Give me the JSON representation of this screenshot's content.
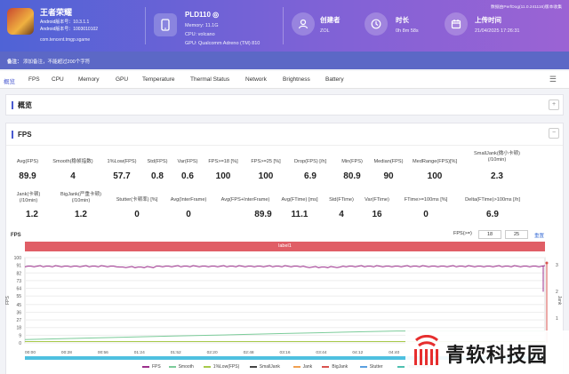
{
  "header": {
    "app_name": "王者荣耀",
    "android_version": "Android版本号：10.3.1.1",
    "android_version_code": "Android版本号：1003010102",
    "package": "com.tencent.tmgp.sgame",
    "device_name": "PLD110 ◎",
    "memory": "Memory: 11.1G",
    "cpu": "CPU: volcano",
    "gpu": "GPU: Qualcomm Adreno (TM) 810",
    "creator_label": "创建者",
    "creator_value": "ZOL",
    "duration_label": "时长",
    "duration_value": "0h 8m 58s",
    "upload_label": "上传时间",
    "upload_value": "21/04/2025 17:26:31",
    "corner_note": "数据由PerfDog(11.0.241116)版本收集"
  },
  "remark": {
    "label": "备注：",
    "value": "添加备注，不能超过200个字符"
  },
  "tabs": [
    "概览",
    "FPS",
    "CPU",
    "Memory",
    "GPU",
    "Temperature",
    "Thermal Status",
    "Network",
    "Brightness",
    "Battery"
  ],
  "overview_title": "概览",
  "fps_title": "FPS",
  "stats_row1": [
    {
      "label": "Avg(FPS)",
      "value": "89.9"
    },
    {
      "label": "Smooth(稳帧指数)",
      "value": "4"
    },
    {
      "label": "1%Low(FPS)",
      "value": "57.7"
    },
    {
      "label": "Std(FPS)",
      "value": "0.8"
    },
    {
      "label": "Var(FPS)",
      "value": "0.6"
    },
    {
      "label": "FPS>=18 [%]",
      "value": "100"
    },
    {
      "label": "FPS>=25 [%]",
      "value": "100"
    },
    {
      "label": "Drop(FPS) [/h]",
      "value": "6.9"
    },
    {
      "label": "Min(FPS)",
      "value": "80.9"
    },
    {
      "label": "Median(FPS)",
      "value": "90"
    },
    {
      "label": "MedRange(FPS)[%]",
      "value": "100"
    },
    {
      "label": "SmallJank(微小卡顿)\n(/10min)",
      "value": "2.3"
    }
  ],
  "stats_row2": [
    {
      "label": "Jank(卡顿)\n(/10min)",
      "value": "1.2"
    },
    {
      "label": "BigJank(严重卡顿)\n(/10min)",
      "value": "1.2"
    },
    {
      "label": "Stutter(卡顿率) [%]",
      "value": "0"
    },
    {
      "label": "Avg(InterFrame)",
      "value": "0"
    },
    {
      "label": "Avg(FPS+InterFrame)",
      "value": "89.9"
    },
    {
      "label": "Avg(FTime) [ms]",
      "value": "11.1"
    },
    {
      "label": "Std(FTime)",
      "value": "4"
    },
    {
      "label": "Var(FTime)",
      "value": "16"
    },
    {
      "label": "FTime>=100ms [%]",
      "value": "0"
    },
    {
      "label": "Delta(FTime)>100ms [/h]",
      "value": "6.9"
    }
  ],
  "chart_controls": {
    "filter_label": "FPS(>=)",
    "filter_a": "18",
    "filter_b": "25",
    "reset": "重置"
  },
  "chart_data": {
    "type": "line",
    "title": "FPS",
    "band_label": "label1",
    "ylabel": "FPS",
    "ylabel_right": "Jank",
    "ylim": [
      0,
      100
    ],
    "y_ticks": [
      100,
      91,
      82,
      73,
      64,
      55,
      45,
      36,
      27,
      18,
      9,
      0
    ],
    "y_ticks_right": [
      3,
      2,
      1
    ],
    "x_ticks": [
      "00:00",
      "00:28",
      "00:56",
      "01:24",
      "01:52",
      "02:20",
      "02:48",
      "03:16",
      "03:44",
      "04:12",
      "04:40",
      "05:08",
      "05:36",
      "06:04",
      "06:32"
    ],
    "series": [
      {
        "name": "FPS",
        "color": "#9c2f8c",
        "approx_values": [
          90,
          90,
          90,
          89,
          90,
          90,
          90,
          90,
          89,
          90,
          90,
          90,
          90,
          90,
          90
        ]
      },
      {
        "name": "Smooth",
        "color": "#7ccc9a",
        "approx_values": [
          4,
          5,
          6,
          7,
          8,
          9,
          10,
          11,
          12,
          13,
          14,
          14,
          14,
          14,
          14
        ]
      },
      {
        "name": "1%Low(FPS)",
        "color": "#a7c94a"
      },
      {
        "name": "SmallJank",
        "color": "#444444"
      },
      {
        "name": "Jank",
        "color": "#f0a050"
      },
      {
        "name": "BigJank",
        "color": "#d9534f"
      },
      {
        "name": "Stutter",
        "color": "#5aa0e0"
      },
      {
        "name": "InterFrame",
        "color": "#4ec0b0"
      }
    ]
  },
  "logo_text": "青软科技园"
}
